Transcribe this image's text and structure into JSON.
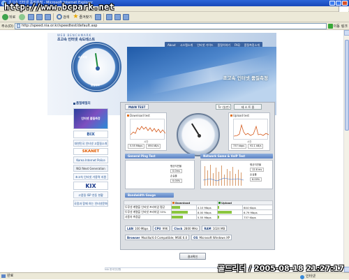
{
  "window": {
    "title": "초고속 인터넷 품질측정 - Microsoft Internet Explorer",
    "watermark": "http://www.bcpark.net"
  },
  "toolbar": {
    "back": "뒤로",
    "search": "검색",
    "favorites": "즐겨찾기"
  },
  "address": {
    "label": "주소(D)",
    "url": "http://speed.nia.or.kr/speedtest/default.asp",
    "go": "이동",
    "links": "링크"
  },
  "header": {
    "brand_en": "WEB BENCHMARK",
    "brand_kr": "초고속 인터넷 속도테스트",
    "nav": [
      "About",
      "시스템소개",
      "인터넷 가이드",
      "품질이야기",
      "FAQ",
      "품질측정소개"
    ],
    "banner_title": "초고속 인터넷 품질측정",
    "dial_labels": {
      "top_left": "속도측정",
      "bottom": "품질정보"
    }
  },
  "leftnav": {
    "title": "품질패밀리",
    "items": [
      "인터넷 품질측정",
      "BIX",
      "대한민국 인터넷 고품질소개",
      "SKANET",
      "Korea Internet Police",
      "NGI Next Generation",
      "초고속 인터넷 가용력 지원",
      "KIX",
      "고품질 ISP 연동 현황",
      "국정과 함께 하는 인터넷문화"
    ]
  },
  "panel": {
    "tab": "MAIN TEST",
    "mode": "Tir (일반)",
    "test_btn": "테 스 트 중",
    "download": {
      "title": "Download test",
      "unit": "Mbps",
      "xlabel": "시간",
      "mbps": "5.55 Mbps",
      "kbs": "694 kB/s"
    },
    "upload": {
      "title": "Upload test",
      "unit": "Mbps",
      "xlabel": "시간",
      "mbps": "737 kbps",
      "kbs": "92.1 kB/s"
    },
    "general_ping": "General Ping Test",
    "network_voip": "Network Game & VoIP Test",
    "lower_left": {
      "ping_label": "평균지연율",
      "ping_val": "0.0ms",
      "loss_label": "손실율",
      "loss_val": "0.00%"
    },
    "lower_right": {
      "ping_label": "평균지연율",
      "ping_val": "12.6 ms",
      "loss_label": "손실율",
      "loss_val": "6.00%"
    },
    "bandwidth_gauge": "Bandwidth Gauge",
    "bw_table": {
      "headers": [
        "Download",
        "Upload"
      ],
      "rows": [
        {
          "label": "두루넷 계열을 인터넷 프리미엄 평균",
          "dl": "4.10 Mbps",
          "dl_pct": 0.34,
          "ul": "644 Kbps",
          "ul_pct": 0.06
        },
        {
          "label": "두루넷 계열을 인터넷 프리미엄 33%",
          "dl": "8.00 Mbps",
          "dl_pct": 0.67,
          "ul": "6.79 Mbps",
          "ul_pct": 0.57
        },
        {
          "label": "사용자 측정값",
          "dl": "5.55 Mbps",
          "dl_pct": 0.46,
          "ul": "737 Kbps",
          "ul_pct": 0.06
        }
      ]
    },
    "specs": {
      "lan_label": "LAN",
      "lan_val": "100 Mbps",
      "cpu_label": "CPU",
      "cpu_val": "996",
      "clock_label": "Clock",
      "clock_val": "2800 MHz",
      "ram_label": "RAM",
      "ram_val": "1024 MB",
      "browser_label": "Browser",
      "browser_val": "Mozilla/4.0 Compatible; MSIE 6.0",
      "os_label": "OS",
      "os_val": "Microsoft Windows XP"
    },
    "more_btn": "결과확인"
  },
  "footer": {
    "text": "NIA 한국전산원"
  },
  "statusbar": {
    "status": "완료",
    "zone": "인터넷"
  },
  "overlay": {
    "timestamp": "골드리더 / 2005-08-18 21:27:17"
  }
}
